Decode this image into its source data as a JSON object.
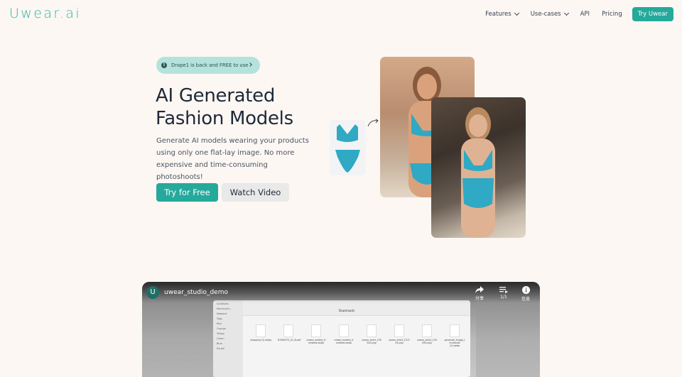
{
  "nav": {
    "logo": "Uwear.ai",
    "links": [
      {
        "label": "Features",
        "dropdown": true
      },
      {
        "label": "Use-cases",
        "dropdown": true
      },
      {
        "label": "API",
        "dropdown": false
      },
      {
        "label": "Pricing",
        "dropdown": false
      }
    ],
    "cta": "Try Uwear"
  },
  "hero": {
    "badge": "Drape1 is back and FREE to use",
    "title_line1": "AI Generated",
    "title_line2": "Fashion Models",
    "description": "Generate AI models wearing your products using only one flat-lay image. No more expensive and time-consuming photoshoots!",
    "primary_button": "Try for Free",
    "secondary_button": "Watch Video"
  },
  "video": {
    "channel_initial": "U",
    "title": "uwear_studio_demo",
    "actions": [
      {
        "icon": "share-icon",
        "label": "分享"
      },
      {
        "icon": "playlist-icon",
        "label": "1/1"
      },
      {
        "icon": "info-icon",
        "label": "信息"
      }
    ],
    "finder_location": "Downloads",
    "finder_sidebar": [
      "Locations",
      "Macintosh...",
      "Network",
      "Tags",
      "Red",
      "Orange",
      "Yellow",
      "Green",
      "Blue",
      "Purple"
    ],
    "files": [
      "shopping (1).webp",
      "8706437S_01_B.avif",
      "create_models_fr umbled.webp",
      "create_models_fr umbled.webp",
      "uwear_tshirt_239 542.png",
      "uwear_tshirt_2371 45.png",
      "uwear_tshirt_239 630.png",
      "generate_image_t humbnail (1).webp"
    ]
  },
  "colors": {
    "accent": "#25a99b",
    "background": "#fcf7f3",
    "badge_bg": "#b5e3db",
    "swimsuit": "#2fa9c4"
  }
}
